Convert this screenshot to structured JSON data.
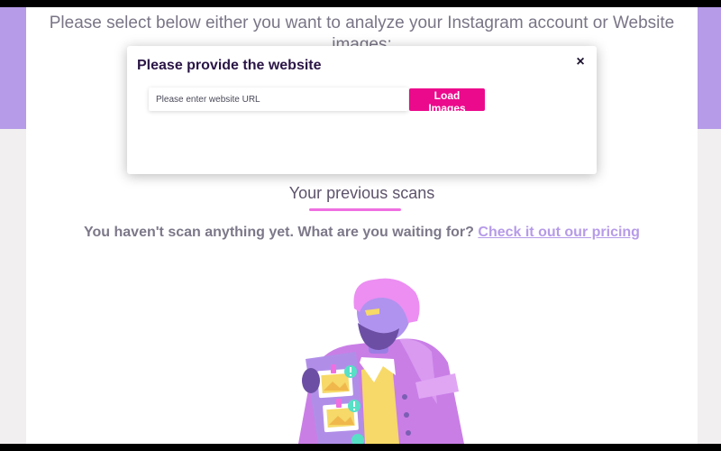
{
  "page": {
    "instructions": "Please select below either you want to analyze your Instagram account or Website images:"
  },
  "modal": {
    "title": "Please provide the website",
    "close_label": "×",
    "url_placeholder": "Please enter website URL",
    "load_button_label": "Load Images"
  },
  "scans": {
    "heading": "Your previous scans",
    "empty_text": "You haven't scan anything yet. What are you waiting for?",
    "pricing_link": "Check it out our pricing"
  },
  "illustration": {
    "name": "person-holding-photos-illustration"
  },
  "colors": {
    "brand_purple": "#b69be8",
    "accent_pink": "#ec0a8c",
    "underline_pink": "#ef6fe1",
    "title_dark": "#2a1546"
  }
}
